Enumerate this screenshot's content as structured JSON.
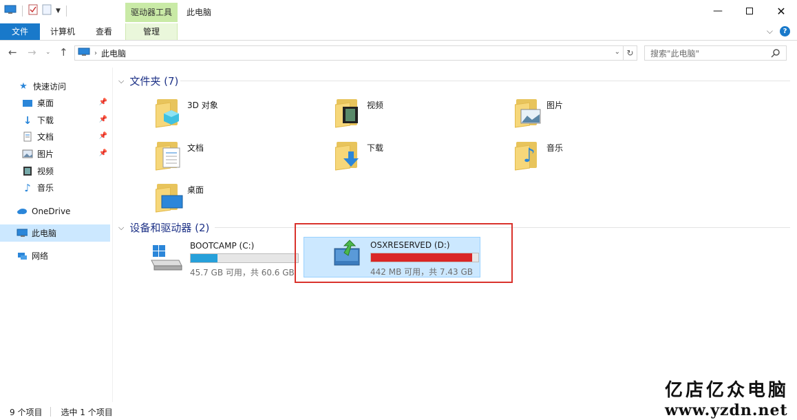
{
  "window": {
    "title": "此电脑",
    "context_tab_header": "驱动器工具",
    "controls": [
      "minimize-icon",
      "maximize-icon",
      "close-icon"
    ]
  },
  "ribbon": {
    "tabs": [
      {
        "label": "文件",
        "active": true
      },
      {
        "label": "计算机"
      },
      {
        "label": "查看"
      },
      {
        "label": "管理"
      }
    ]
  },
  "address": {
    "crumb": "此电脑",
    "search_placeholder": "搜索\"此电脑\""
  },
  "nav": {
    "quick_access": "快速访问",
    "items": [
      {
        "label": "桌面",
        "pinned": true
      },
      {
        "label": "下载",
        "pinned": true
      },
      {
        "label": "文档",
        "pinned": true
      },
      {
        "label": "图片",
        "pinned": true
      },
      {
        "label": "视频"
      },
      {
        "label": "音乐"
      }
    ],
    "onedrive": "OneDrive",
    "this_pc": "此电脑",
    "network": "网络"
  },
  "folders": {
    "header": "文件夹 (7)",
    "items": [
      {
        "label": "3D 对象",
        "icon": "3d-objects-icon"
      },
      {
        "label": "视频",
        "icon": "videos-icon"
      },
      {
        "label": "图片",
        "icon": "pictures-icon"
      },
      {
        "label": "文档",
        "icon": "documents-icon"
      },
      {
        "label": "下载",
        "icon": "downloads-icon"
      },
      {
        "label": "音乐",
        "icon": "music-icon"
      },
      {
        "label": "桌面",
        "icon": "desktop-icon"
      }
    ]
  },
  "drives": {
    "header": "设备和驱动器 (2)",
    "items": [
      {
        "name": "BOOTCAMP (C:)",
        "size_text": "45.7 GB 可用，共 60.6 GB",
        "used_fraction": 0.25,
        "bar_color": "#26a0da"
      },
      {
        "name": "OSXRESERVED (D:)",
        "size_text": "442 MB 可用，共 7.43 GB",
        "used_fraction": 0.94,
        "bar_color": "#da2626",
        "selected": true
      }
    ]
  },
  "status": {
    "item_count": "9 个项目",
    "selected": "选中 1 个项目"
  },
  "watermark": {
    "cn": "亿店亿众电脑",
    "url": "www.yzdn.net"
  }
}
